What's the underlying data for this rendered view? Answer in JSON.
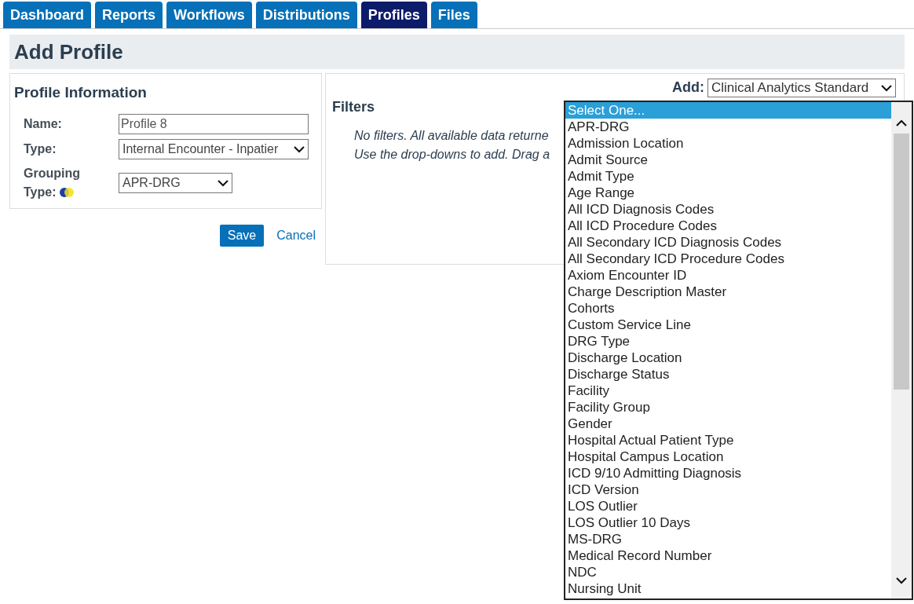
{
  "tabs": [
    {
      "label": "Dashboard",
      "selected": false
    },
    {
      "label": "Reports",
      "selected": false
    },
    {
      "label": "Workflows",
      "selected": false
    },
    {
      "label": "Distributions",
      "selected": false
    },
    {
      "label": "Profiles",
      "selected": true
    },
    {
      "label": "Files",
      "selected": false
    }
  ],
  "page_title": "Add Profile",
  "profile_information": {
    "title": "Profile Information",
    "fields": [
      {
        "kind": "text",
        "label": "Name:",
        "value": "Profile 8"
      },
      {
        "kind": "select",
        "label": "Type:",
        "value": "Internal Encounter - Inpatier"
      },
      {
        "kind": "select",
        "label": "Grouping Type:",
        "value": "APR-DRG",
        "icon": true
      }
    ]
  },
  "buttons": [
    {
      "kind": "primary",
      "label": "Save"
    },
    {
      "kind": "link",
      "label": "Cancel"
    }
  ],
  "filters": {
    "title": "Filters",
    "add_label": "Add:",
    "add_value": "Clinical Analytics Standard",
    "messages": [
      "No filters. All available data returne",
      "Use the drop-downs to add. Drag a"
    ]
  },
  "dropdown_options": [
    {
      "label": "Select One...",
      "selected": true
    },
    {
      "label": "APR-DRG",
      "selected": false
    },
    {
      "label": "Admission Location",
      "selected": false
    },
    {
      "label": "Admit Source",
      "selected": false
    },
    {
      "label": "Admit Type",
      "selected": false
    },
    {
      "label": "Age Range",
      "selected": false
    },
    {
      "label": "All ICD Diagnosis Codes",
      "selected": false
    },
    {
      "label": "All ICD Procedure Codes",
      "selected": false
    },
    {
      "label": "All Secondary ICD Diagnosis Codes",
      "selected": false
    },
    {
      "label": "All Secondary ICD Procedure Codes",
      "selected": false
    },
    {
      "label": "Axiom Encounter ID",
      "selected": false
    },
    {
      "label": "Charge Description Master",
      "selected": false
    },
    {
      "label": "Cohorts",
      "selected": false
    },
    {
      "label": "Custom Service Line",
      "selected": false
    },
    {
      "label": "DRG Type",
      "selected": false
    },
    {
      "label": "Discharge Location",
      "selected": false
    },
    {
      "label": "Discharge Status",
      "selected": false
    },
    {
      "label": "Facility",
      "selected": false
    },
    {
      "label": "Facility Group",
      "selected": false
    },
    {
      "label": "Gender",
      "selected": false
    },
    {
      "label": "Hospital Actual Patient Type",
      "selected": false
    },
    {
      "label": "Hospital Campus Location",
      "selected": false
    },
    {
      "label": "ICD 9/10 Admitting Diagnosis",
      "selected": false
    },
    {
      "label": "ICD Version",
      "selected": false
    },
    {
      "label": "LOS Outlier",
      "selected": false
    },
    {
      "label": "LOS Outlier 10 Days",
      "selected": false
    },
    {
      "label": "MS-DRG",
      "selected": false
    },
    {
      "label": "Medical Record Number",
      "selected": false
    },
    {
      "label": "NDC",
      "selected": false
    },
    {
      "label": "Nursing Unit",
      "selected": false
    }
  ]
}
